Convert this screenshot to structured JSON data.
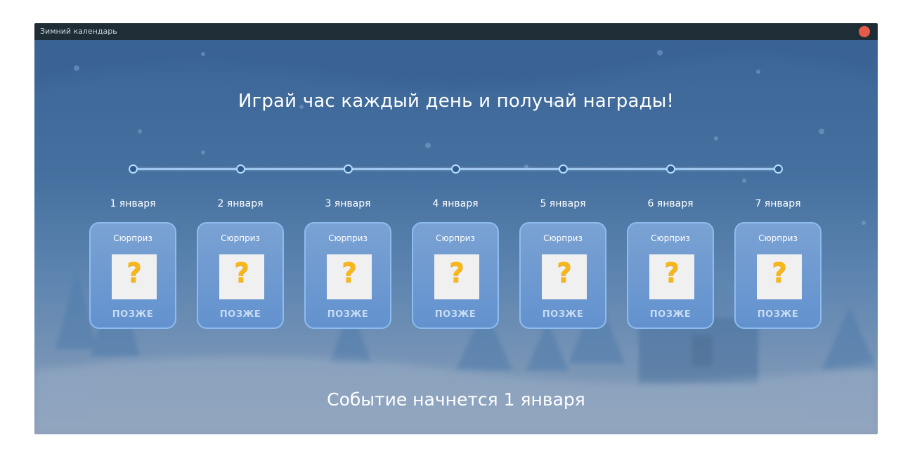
{
  "window": {
    "title": "Зимний календарь",
    "close_color": "#e55b47"
  },
  "headline": "Играй час каждый день и получай награды!",
  "timeline": {
    "days": [
      {
        "label": "1 января",
        "card_title": "Сюрприз",
        "reward_icon": "question-mark",
        "status": "ПОЗЖЕ"
      },
      {
        "label": "2 января",
        "card_title": "Сюрприз",
        "reward_icon": "question-mark",
        "status": "ПОЗЖЕ"
      },
      {
        "label": "3 января",
        "card_title": "Сюрприз",
        "reward_icon": "question-mark",
        "status": "ПОЗЖЕ"
      },
      {
        "label": "4 января",
        "card_title": "Сюрприз",
        "reward_icon": "question-mark",
        "status": "ПОЗЖЕ"
      },
      {
        "label": "5 января",
        "card_title": "Сюрприз",
        "reward_icon": "question-mark",
        "status": "ПОЗЖЕ"
      },
      {
        "label": "6 января",
        "card_title": "Сюрприз",
        "reward_icon": "question-mark",
        "status": "ПОЗЖЕ"
      },
      {
        "label": "7 января",
        "card_title": "Сюрприз",
        "reward_icon": "question-mark",
        "status": "ПОЗЖЕ"
      }
    ]
  },
  "question_mark": "?",
  "footer": "Событие начнется 1 января",
  "colors": {
    "accent_line": "#9ec8f0",
    "card_border": "#8dbcf0",
    "question_mark": "#f5b71b",
    "status_text": "#c8dcf2"
  }
}
